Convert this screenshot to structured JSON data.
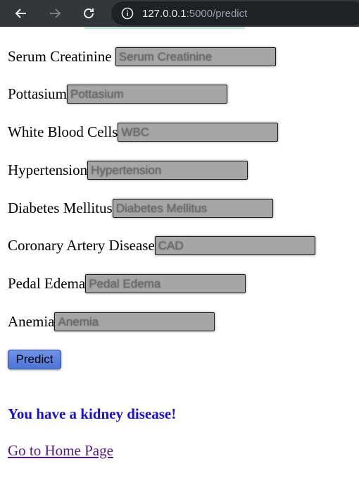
{
  "browser": {
    "url_host": "127.0.0.1",
    "url_rest": ":5000/predict",
    "back_icon": "arrow-left-icon",
    "forward_icon": "arrow-right-icon",
    "reload_icon": "reload-icon",
    "site_info_icon": "info-circle-icon"
  },
  "form": {
    "fields": [
      {
        "label": "Serum Creatinine ",
        "placeholder": "Serum Creatinine"
      },
      {
        "label": "Pottasium",
        "placeholder": "Pottasium"
      },
      {
        "label": "White Blood Cells",
        "placeholder": "WBC"
      },
      {
        "label": "Hypertension",
        "placeholder": "Hypertension"
      },
      {
        "label": "Diabetes Mellitus",
        "placeholder": "Diabetes Mellitus"
      },
      {
        "label": "Coronary Artery Disease",
        "placeholder": "CAD"
      },
      {
        "label": "Pedal Edema",
        "placeholder": "Pedal Edema"
      },
      {
        "label": "Anemia",
        "placeholder": "Anemia"
      }
    ],
    "submit_label": "Predict"
  },
  "result": {
    "message": "You have a kidney disease!",
    "color": "#1a0fd6"
  },
  "link": {
    "home_label": "Go to Home Page"
  }
}
